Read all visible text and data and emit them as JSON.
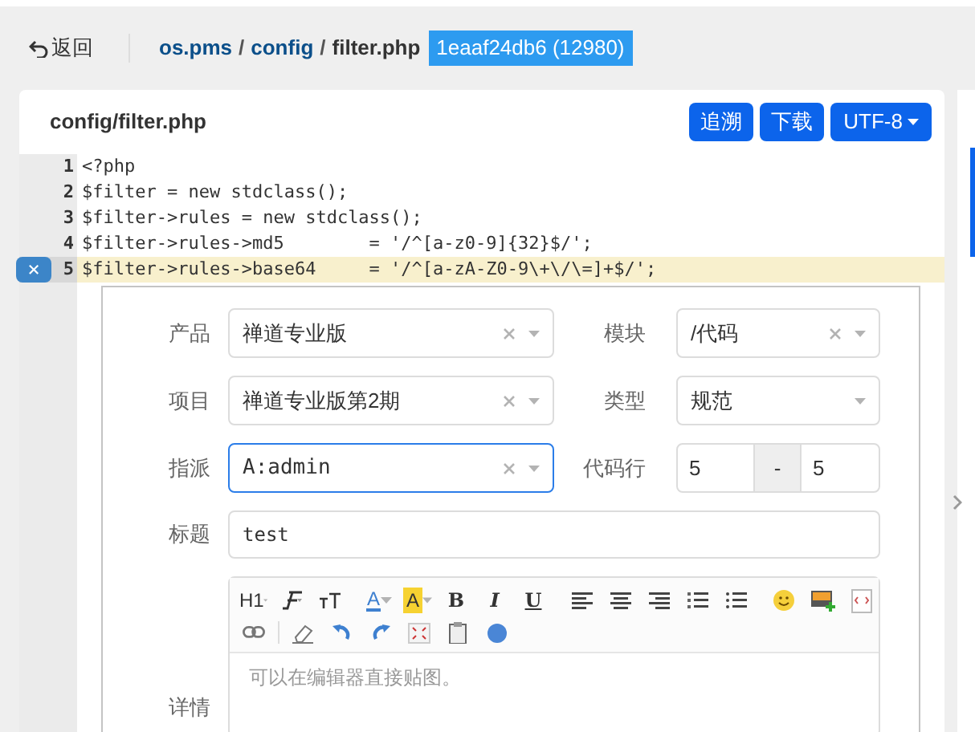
{
  "header": {
    "back": "返回",
    "breadcrumb": [
      {
        "label": "os.pms",
        "kind": "link"
      },
      {
        "label": "config",
        "kind": "link"
      },
      {
        "label": "filter.php",
        "kind": "current"
      }
    ],
    "separator": "/",
    "revision": "1eaaf24db6 (12980)"
  },
  "file": {
    "title": "config/filter.php",
    "buttons": [
      "追溯",
      "下载"
    ],
    "encoding": "UTF-8"
  },
  "code": [
    {
      "number": "1",
      "text": "<?php",
      "selected": false
    },
    {
      "number": "2",
      "text": "$filter = new stdclass();",
      "selected": false
    },
    {
      "number": "3",
      "text": "$filter->rules = new stdclass();",
      "selected": false
    },
    {
      "number": "4",
      "text": "$filter->rules->md5        = '/^[a-z0-9]{32}$/';",
      "selected": false
    },
    {
      "number": "5",
      "text": "$filter->rules->base64     = '/^[a-zA-Z0-9\\+\\/\\=]+$/';",
      "selected": true
    }
  ],
  "close_marker": "×",
  "form": {
    "rows": [
      {
        "label": "产品",
        "value": "禅道专业版",
        "clearable": true,
        "focused": false,
        "right_label": "模块",
        "right_value": "/代码",
        "right_clearable": true
      },
      {
        "label": "项目",
        "value": "禅道专业版第2期",
        "clearable": true,
        "focused": false,
        "right_label": "类型",
        "right_value": "规范",
        "right_clearable": false
      },
      {
        "label": "指派",
        "value": "A:admin",
        "clearable": true,
        "focused": true,
        "right_label": "代码行",
        "range_from": "5",
        "range_sep": "-",
        "range_to": "5"
      }
    ],
    "title_label": "标题",
    "title_value": "test",
    "detail_label": "详情",
    "editor_placeholder": "可以在编辑器直接贴图。",
    "toolbar_text": [
      "H1",
      "A",
      "A",
      "B",
      "I",
      "U"
    ]
  }
}
